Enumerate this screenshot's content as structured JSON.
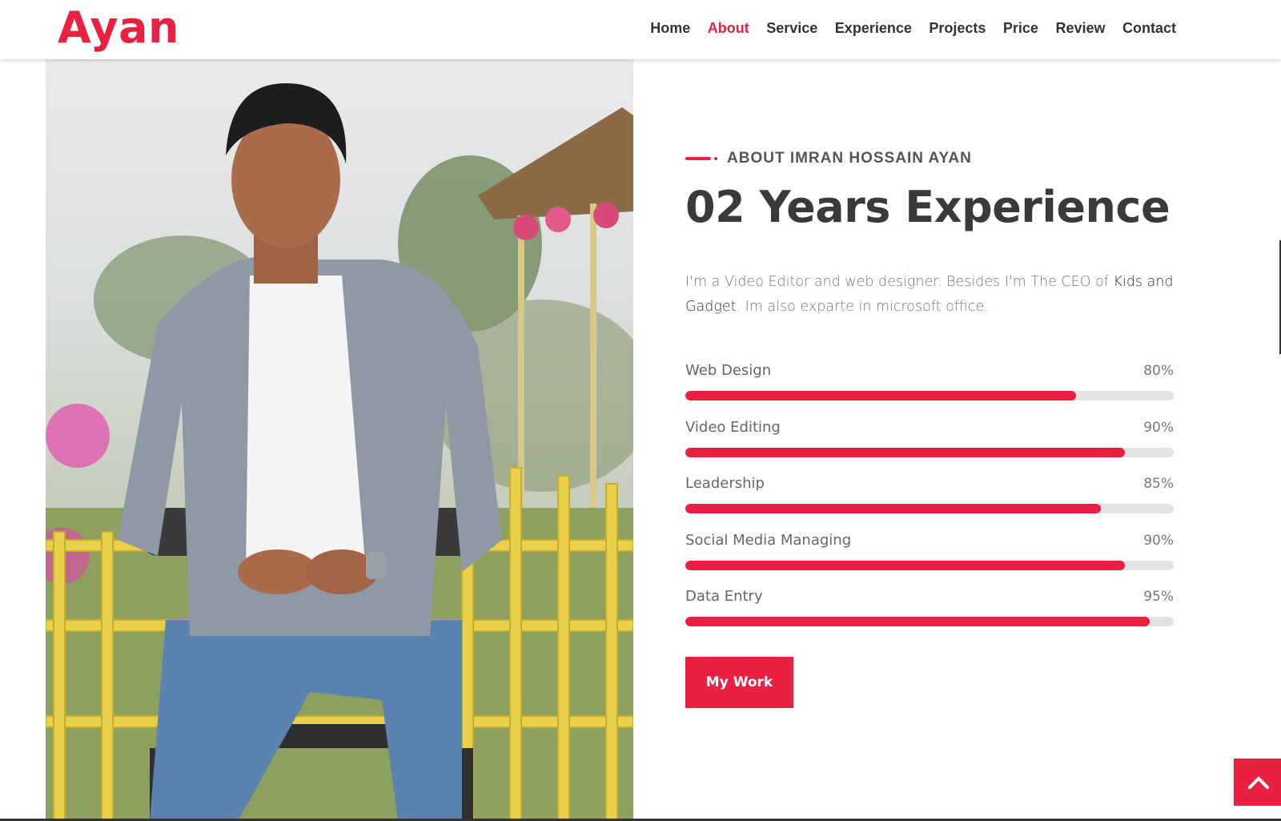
{
  "brand": {
    "logo": "Ayan",
    "accent_color": "#ea2040"
  },
  "nav": {
    "items": [
      {
        "label": "Home",
        "active": false
      },
      {
        "label": "About",
        "active": true
      },
      {
        "label": "Service",
        "active": false
      },
      {
        "label": "Experience",
        "active": false
      },
      {
        "label": "Projects",
        "active": false
      },
      {
        "label": "Price",
        "active": false
      },
      {
        "label": "Review",
        "active": false
      },
      {
        "label": "Contact",
        "active": false
      }
    ]
  },
  "about": {
    "subtitle": "ABOUT IMRAN HOSSAIN AYAN",
    "heading": "02 Years Experience",
    "description_part1": "I'm a Video Editor and web designer. Besides I'm The CEO of ",
    "description_highlight": "Kids and Gadget",
    "description_part2": ". Im also exparte in microsoft office.",
    "skills": [
      {
        "name": "Web Design",
        "percent_label": "80%",
        "value": 80
      },
      {
        "name": "Video Editing",
        "percent_label": "90%",
        "value": 90
      },
      {
        "name": "Leadership",
        "percent_label": "85%",
        "value": 85
      },
      {
        "name": "Social Media Managing",
        "percent_label": "90%",
        "value": 90
      },
      {
        "name": "Data Entry",
        "percent_label": "95%",
        "value": 95
      }
    ],
    "button_label": "My Work"
  },
  "icons": {
    "scroll_top": "chevron-up-icon"
  }
}
